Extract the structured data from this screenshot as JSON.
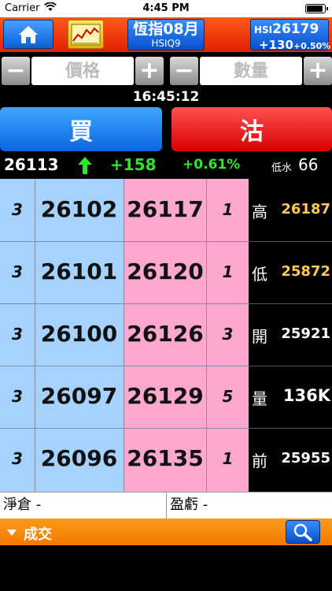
{
  "status_bar": {
    "carrier": "Carrier",
    "time": "4:45 PM"
  },
  "header": {
    "contract_name": "恆指08月",
    "contract_code": "HSIQ9",
    "index_label": "HSI",
    "index_value": "26179",
    "index_change": "+130",
    "index_change_pct": "+0.50%"
  },
  "order": {
    "price_placeholder": "價格",
    "quantity_placeholder": "數量",
    "minus": "−",
    "plus": "+"
  },
  "clock": "16:45:12",
  "actions": {
    "buy_label": "買",
    "sell_label": "沽"
  },
  "quote": {
    "last": "26113",
    "change": "+158",
    "change_pct": "+0.61%",
    "discount_label": "低水",
    "discount_value": "66"
  },
  "order_book": {
    "rows": [
      {
        "bid_qty": "3",
        "bid_price": "26102",
        "ask_price": "26117",
        "ask_qty": "1"
      },
      {
        "bid_qty": "3",
        "bid_price": "26101",
        "ask_price": "26120",
        "ask_qty": "1"
      },
      {
        "bid_qty": "3",
        "bid_price": "26100",
        "ask_price": "26126",
        "ask_qty": "3"
      },
      {
        "bid_qty": "3",
        "bid_price": "26097",
        "ask_price": "26129",
        "ask_qty": "5"
      },
      {
        "bid_qty": "3",
        "bid_price": "26096",
        "ask_price": "26135",
        "ask_qty": "1"
      }
    ]
  },
  "stats": [
    {
      "label": "高",
      "value": "26187",
      "color": "#ffc85a"
    },
    {
      "label": "低",
      "value": "25872",
      "color": "#ffc85a"
    },
    {
      "label": "開",
      "value": "25921",
      "color": "#ffffff"
    },
    {
      "label": "量",
      "value": "136K",
      "color": "#ffffff"
    },
    {
      "label": "前",
      "value": "25955",
      "color": "#ffffff"
    }
  ],
  "position": {
    "net_label": "淨倉 -",
    "pnl_label": "盈虧 -"
  },
  "trades": {
    "label": "成交"
  },
  "colors": {
    "up": "#2ee62e",
    "bid_bg": "#a6d2ff",
    "ask_bg": "#ffa8cf",
    "header_bg": "#ff3a0a"
  }
}
